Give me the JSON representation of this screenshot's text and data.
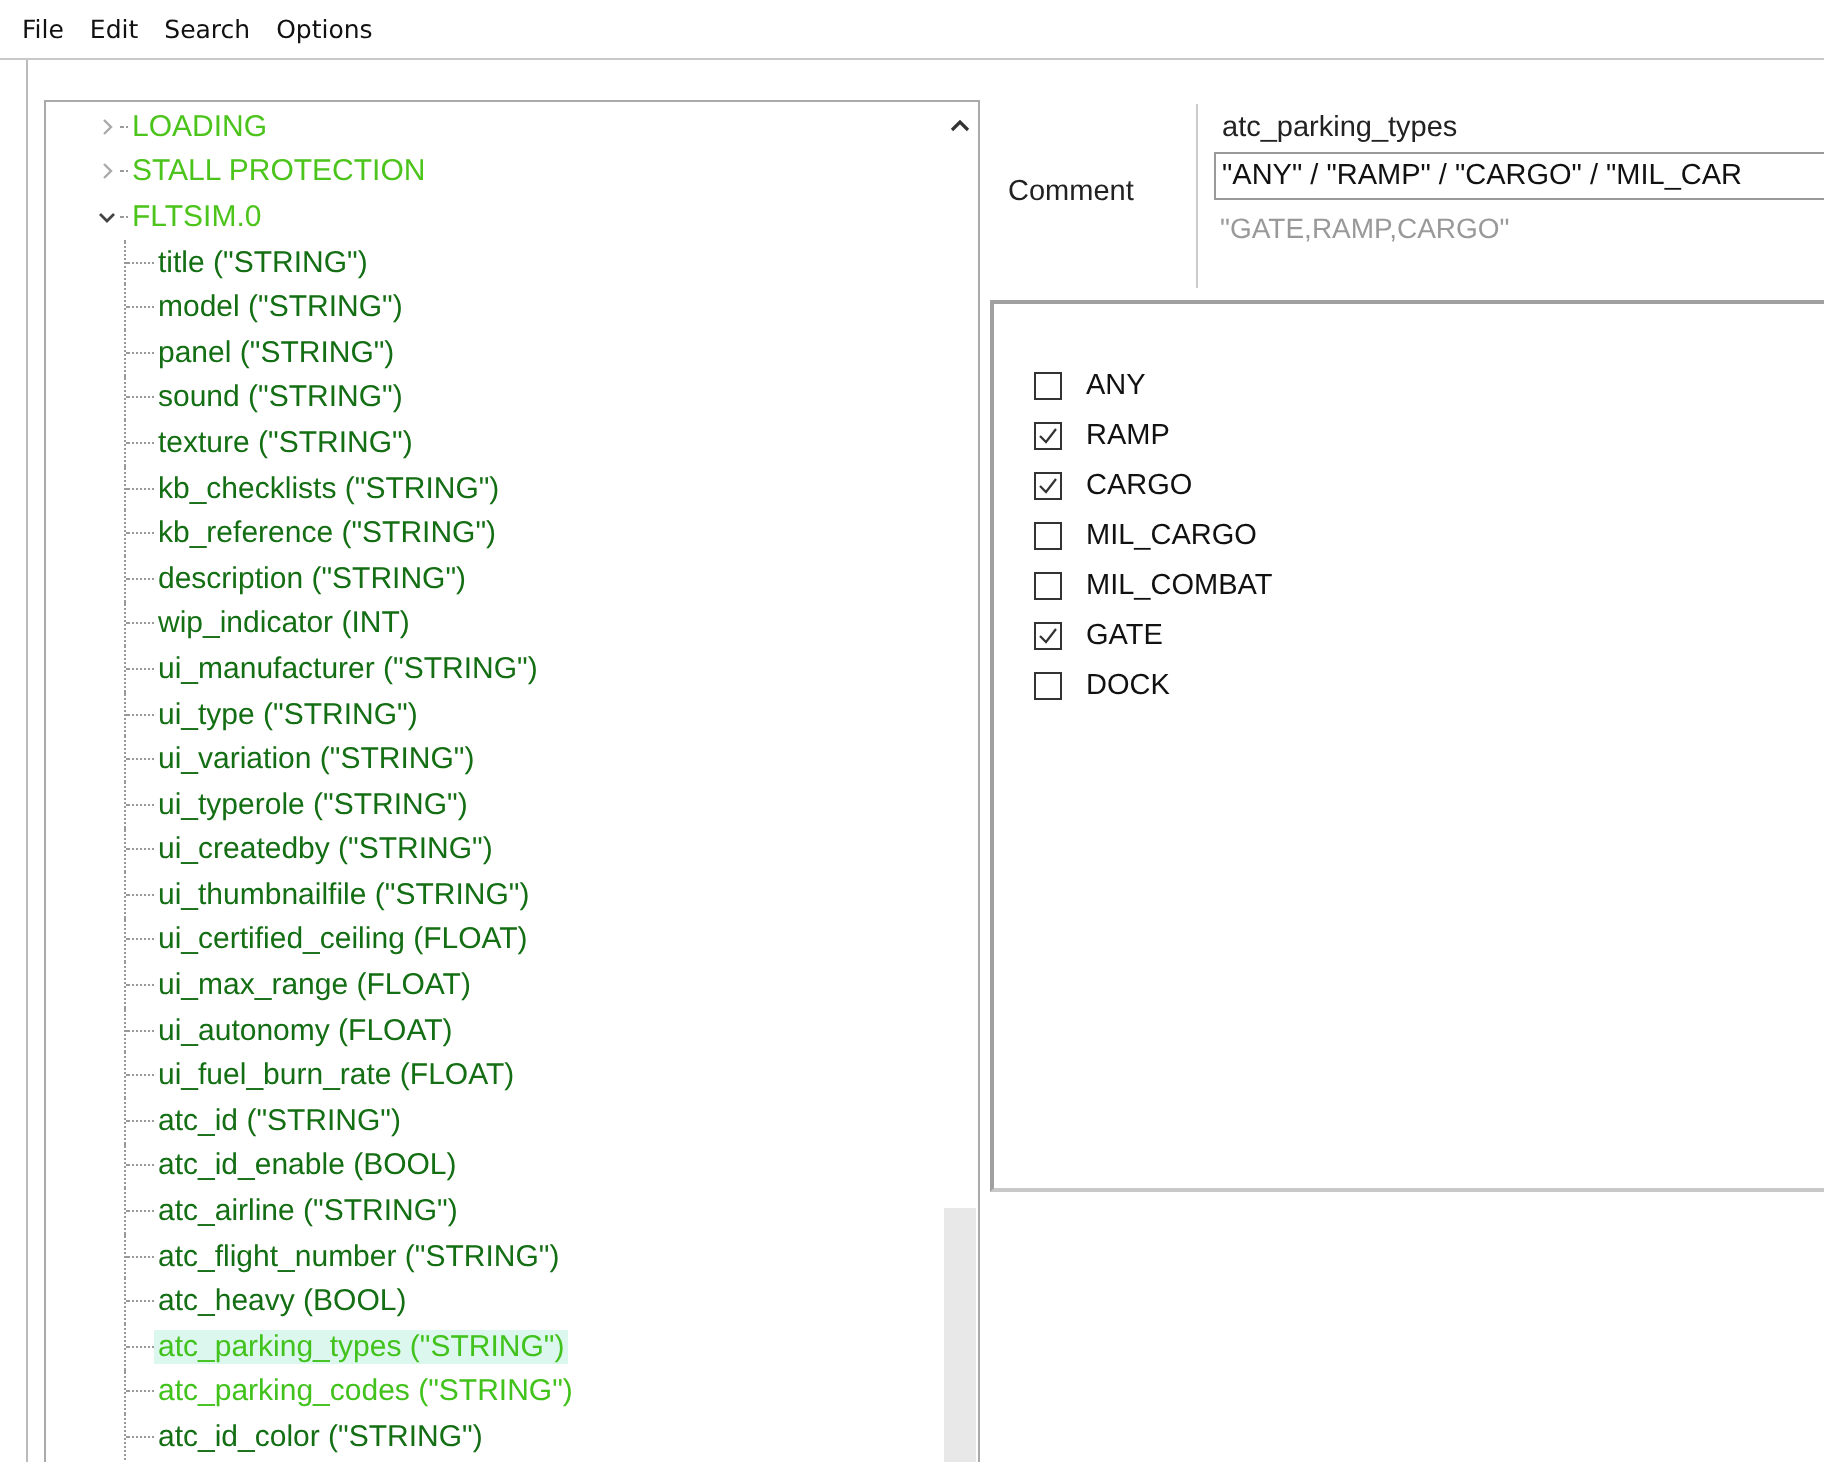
{
  "menu": [
    "File",
    "Edit",
    "Search",
    "Options"
  ],
  "tree": [
    {
      "label": "LOADING",
      "expanded": false,
      "color": "#4cc41c"
    },
    {
      "label": "STALL PROTECTION",
      "expanded": false,
      "color": "#4cc41c"
    },
    {
      "label": "FLTSIM.0",
      "expanded": true,
      "color": "#4cc41c",
      "children": [
        {
          "label": "title (\"STRING\")",
          "color": "#146e14",
          "selected": false
        },
        {
          "label": "model (\"STRING\")",
          "color": "#146e14",
          "selected": false
        },
        {
          "label": "panel (\"STRING\")",
          "color": "#146e14",
          "selected": false
        },
        {
          "label": "sound (\"STRING\")",
          "color": "#146e14",
          "selected": false
        },
        {
          "label": "texture (\"STRING\")",
          "color": "#146e14",
          "selected": false
        },
        {
          "label": "kb_checklists (\"STRING\")",
          "color": "#146e14",
          "selected": false
        },
        {
          "label": "kb_reference (\"STRING\")",
          "color": "#146e14",
          "selected": false
        },
        {
          "label": "description (\"STRING\")",
          "color": "#146e14",
          "selected": false
        },
        {
          "label": "wip_indicator (INT)",
          "color": "#146e14",
          "selected": false
        },
        {
          "label": "ui_manufacturer (\"STRING\")",
          "color": "#146e14",
          "selected": false
        },
        {
          "label": "ui_type (\"STRING\")",
          "color": "#146e14",
          "selected": false
        },
        {
          "label": "ui_variation (\"STRING\")",
          "color": "#146e14",
          "selected": false
        },
        {
          "label": "ui_typerole (\"STRING\")",
          "color": "#146e14",
          "selected": false
        },
        {
          "label": "ui_createdby (\"STRING\")",
          "color": "#146e14",
          "selected": false
        },
        {
          "label": "ui_thumbnailfile (\"STRING\")",
          "color": "#146e14",
          "selected": false
        },
        {
          "label": "ui_certified_ceiling (FLOAT)",
          "color": "#146e14",
          "selected": false
        },
        {
          "label": "ui_max_range (FLOAT)",
          "color": "#146e14",
          "selected": false
        },
        {
          "label": "ui_autonomy (FLOAT)",
          "color": "#146e14",
          "selected": false
        },
        {
          "label": "ui_fuel_burn_rate (FLOAT)",
          "color": "#146e14",
          "selected": false
        },
        {
          "label": "atc_id (\"STRING\")",
          "color": "#146e14",
          "selected": false
        },
        {
          "label": "atc_id_enable (BOOL)",
          "color": "#146e14",
          "selected": false
        },
        {
          "label": "atc_airline (\"STRING\")",
          "color": "#146e14",
          "selected": false
        },
        {
          "label": "atc_flight_number (\"STRING\")",
          "color": "#146e14",
          "selected": false
        },
        {
          "label": "atc_heavy (BOOL)",
          "color": "#146e14",
          "selected": false
        },
        {
          "label": "atc_parking_types (\"STRING\")",
          "color": "#42c21c",
          "selected": true
        },
        {
          "label": "atc_parking_codes (\"STRING\")",
          "color": "#42c21c",
          "selected": false
        },
        {
          "label": "atc_id_color (\"STRING\")",
          "color": "#146e14",
          "selected": false
        }
      ]
    }
  ],
  "editor": {
    "key": "atc_parking_types",
    "comment_label": "Comment",
    "comment": "\"ANY\" / \"RAMP\" / \"CARGO\" / \"MIL_CAR",
    "default": "\"GATE,RAMP,CARGO\""
  },
  "options": [
    {
      "label": "ANY",
      "checked": false
    },
    {
      "label": "RAMP",
      "checked": true
    },
    {
      "label": "CARGO",
      "checked": true
    },
    {
      "label": "MIL_CARGO",
      "checked": false
    },
    {
      "label": "MIL_COMBAT",
      "checked": false
    },
    {
      "label": "GATE",
      "checked": true
    },
    {
      "label": "DOCK",
      "checked": false
    }
  ]
}
